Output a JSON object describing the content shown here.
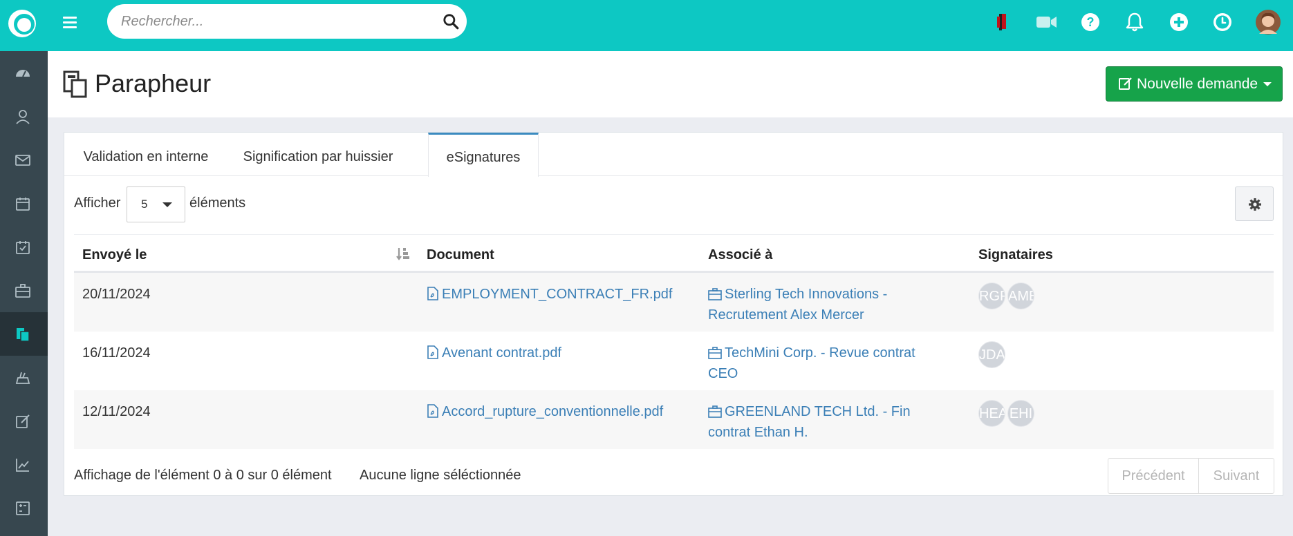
{
  "topbar": {
    "search_placeholder": "Rechercher...",
    "icons": [
      "flag-icon",
      "video-icon",
      "help-icon",
      "bell-icon",
      "plus-icon",
      "clock-icon",
      "user-avatar"
    ]
  },
  "sidebar": {
    "items": [
      "dashboard-icon",
      "contacts-icon",
      "mail-icon",
      "calendar-icon",
      "tasks-icon",
      "cases-icon",
      "parapheur-icon",
      "billing-icon",
      "edit-icon",
      "stats-icon",
      "calculator-icon"
    ],
    "active_index": 6
  },
  "header": {
    "title": "Parapheur",
    "new_button_label": "Nouvelle demande"
  },
  "tabs": [
    {
      "label": "Validation en interne"
    },
    {
      "label": "Signification par huissier"
    },
    {
      "label": "eSignatures"
    }
  ],
  "active_tab": "eSignatures",
  "length_control": {
    "prefix": "Afficher",
    "value": "5",
    "suffix": "éléments"
  },
  "table": {
    "columns": [
      "Envoyé le",
      "Document",
      "Associé à",
      "Signataires"
    ],
    "rows": [
      {
        "date": "20/11/2024",
        "document": "EMPLOYMENT_CONTRACT_FR.pdf",
        "assoc_line1": "Sterling Tech Innovations -",
        "assoc_line2": "Recrutement Alex Mercer",
        "signers": [
          "RGP",
          "AME"
        ]
      },
      {
        "date": "16/11/2024",
        "document": "Avenant contrat.pdf",
        "assoc_line1": "TechMini Corp. - Revue contrat",
        "assoc_line2": "CEO",
        "signers": [
          "JDA"
        ]
      },
      {
        "date": "12/11/2024",
        "document": "Accord_rupture_conventionnelle.pdf",
        "assoc_line1": "GREENLAND TECH Ltd. - Fin",
        "assoc_line2": "contrat Ethan H.",
        "signers": [
          "HEA",
          "EHI"
        ]
      }
    ]
  },
  "footer": {
    "info": "Affichage de l'élément 0 à 0 sur 0 élément",
    "selection": "Aucune ligne séléctionnée",
    "prev_label": "Précédent",
    "next_label": "Suivant"
  },
  "colors": {
    "topbar": "#0dc8c3",
    "sidebar": "#37474f",
    "accent_green": "#16a34a",
    "link": "#3b7fb6"
  }
}
